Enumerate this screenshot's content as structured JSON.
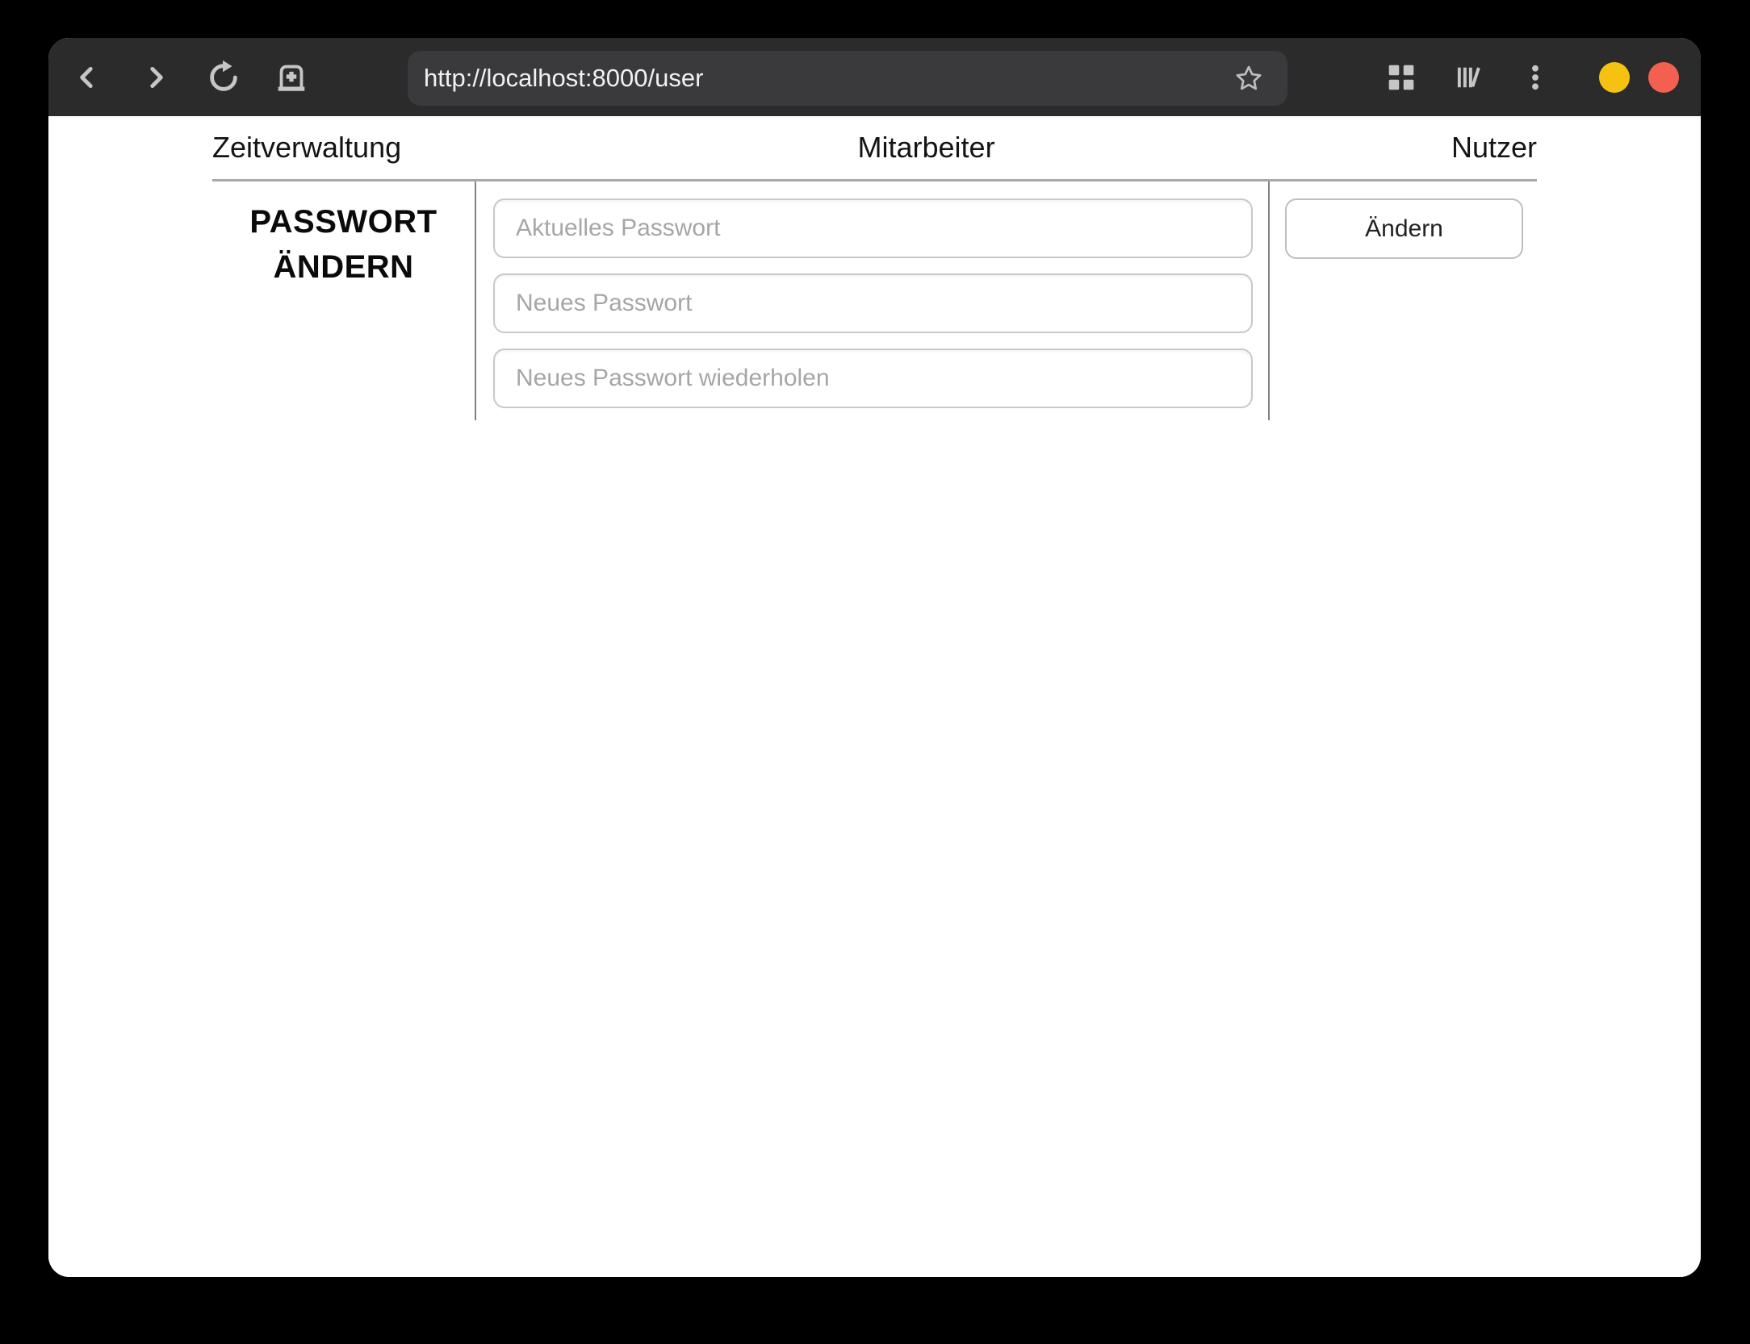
{
  "browser": {
    "toolbar": {
      "url": "http://localhost:8000/user",
      "back_icon": "chevron-left",
      "forward_icon": "chevron-right",
      "reload_icon": "reload-arrow",
      "new_tab_icon": "new-tab",
      "bookmark_icon": "star-outline",
      "grid_icon": "grid-2x2",
      "library_icon": "library-books",
      "menu_icon": "kebab-menu"
    },
    "window_controls": {
      "minimize_color": "#f5c211",
      "close_color": "#f4604f"
    },
    "colors": {
      "toolbar_bg": "#2b2b2b",
      "urlbar_bg": "#3a3a3c",
      "icon_gray": "#c6c6c6"
    }
  },
  "nav": {
    "items": [
      "Zeitverwaltung",
      "Mitarbeiter",
      "Nutzer"
    ]
  },
  "password_form": {
    "heading_line1": "PASSWORT",
    "heading_line2": "ÄNDERN",
    "fields": [
      {
        "placeholder": "Aktuelles Passwort",
        "value": ""
      },
      {
        "placeholder": "Neues Passwort",
        "value": ""
      },
      {
        "placeholder": "Neues Passwort wiederholen",
        "value": ""
      }
    ],
    "submit_label": "Ändern"
  }
}
